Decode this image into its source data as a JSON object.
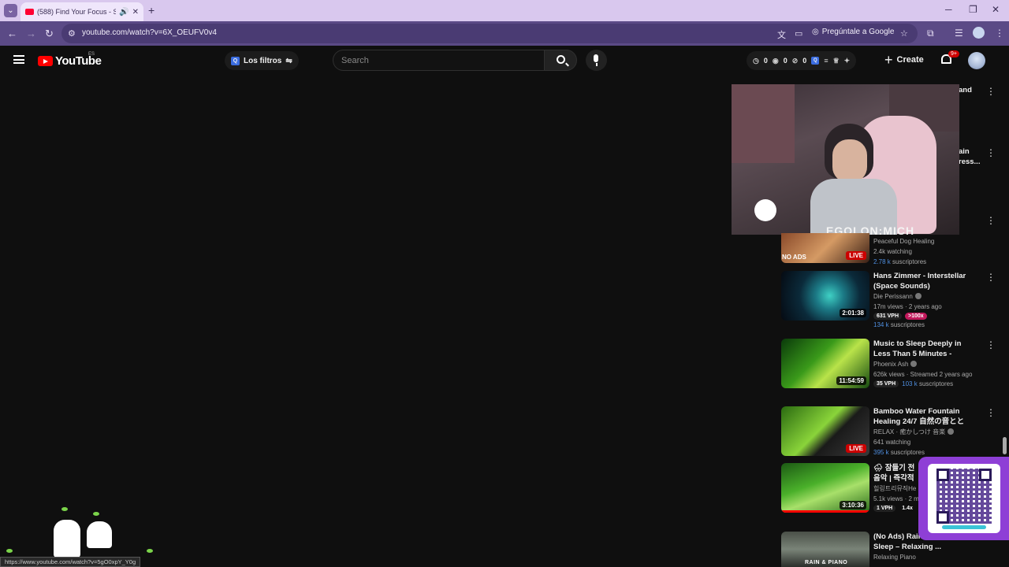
{
  "browser": {
    "tab_title": "(588) Find Your Focus - Sol",
    "url": "youtube.com/watch?v=6X_OEUFV0v4",
    "ask_google": "Pregúntale a Google",
    "status_url": "https://www.youtube.com/watch?v=5gO0xpY_Y0g"
  },
  "header": {
    "logo_text": "YouTube",
    "country": "ES",
    "filters_label": "Los filtros",
    "search_placeholder": "Search",
    "counters": [
      "0",
      "0",
      "0"
    ],
    "create_label": "Create",
    "notif_count": "9+"
  },
  "mini_player": {
    "banner_text": "EGOLON:MICH"
  },
  "clipped_items": {
    "line1": "and",
    "line2a": "ain",
    "line2b": "ress..."
  },
  "recommendations": [
    {
      "title": "",
      "channel": "Peaceful Dog Healing",
      "views": "2.4k watching",
      "badge": "LIVE",
      "thumb_label": "NO ADS",
      "subs_count": "2.78 k",
      "subs_label": "suscriptores"
    },
    {
      "title": "Hans Zimmer - Interstellar (Space Sounds)",
      "channel": "Die Perissann",
      "views": "17m views · 2 years ago",
      "duration": "2:01:38",
      "vph": "631 VPH",
      "outlier": ">100x",
      "subs_count": "134 k",
      "subs_label": "suscriptores"
    },
    {
      "title": "Music to Sleep Deeply in Less Than 5 Minutes - Relaxing ...",
      "channel": "Phoenix Ash",
      "views": "626k views · Streamed 2 years ago",
      "duration": "11:54:59",
      "vph": "35 VPH",
      "subs_count": "103 k",
      "subs_label": "suscriptores"
    },
    {
      "title": "Bamboo Water Fountain Healing 24/7 自然の音ととも...",
      "channel": "RELAX · 癒かしつけ 音楽",
      "views": "641 watching",
      "badge": "LIVE",
      "subs_count": "395 k",
      "subs_label": "suscriptores"
    },
    {
      "title": "🌧 잠들기 전 음악 | 즉각적",
      "channel": "힐링트리뮤직He",
      "views": "5.1k views · 2 m",
      "duration": "3:10:36",
      "vph": "1 VPH",
      "outlier": "1.4x"
    },
    {
      "title": "(No Ads) Rain for Healing Sleep – Relaxing ...",
      "channel": "Relaxing Piano",
      "thumb_label": "RAIN & PIANO"
    }
  ],
  "colors": {
    "accent_red": "#ff0000",
    "subs_blue": "#4f8fe0",
    "outlier_pink": "#c2185b",
    "qr_purple": "#8e3fd6"
  }
}
